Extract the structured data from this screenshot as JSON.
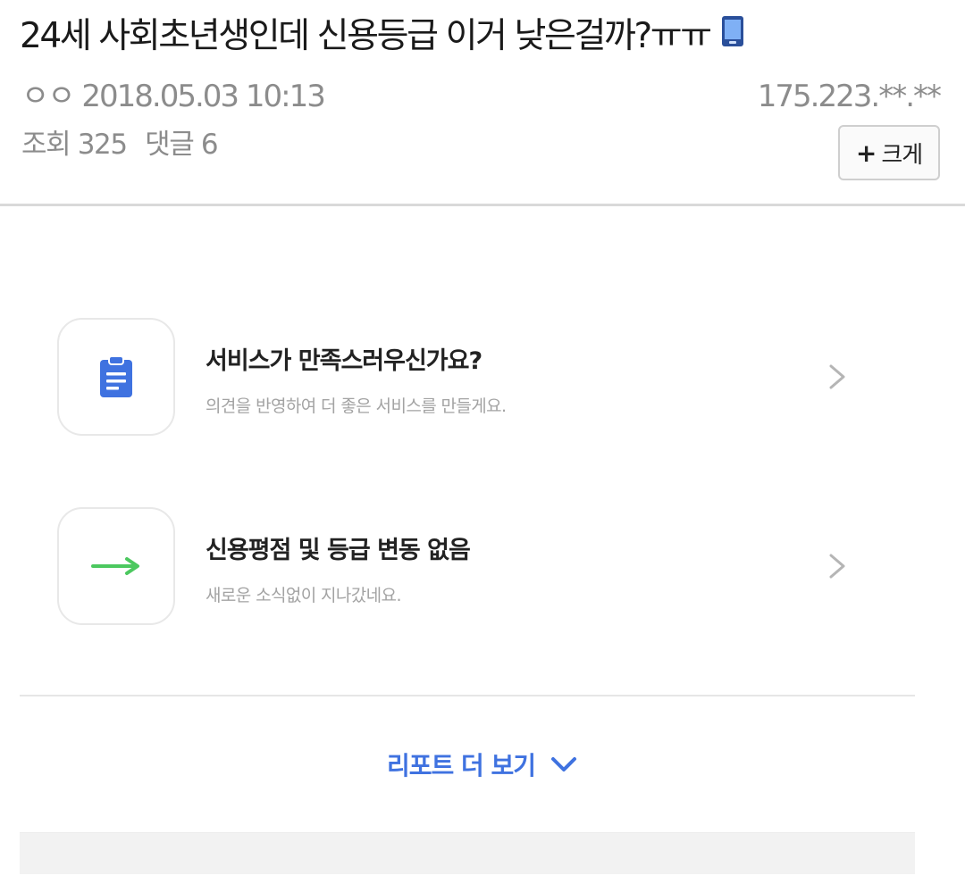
{
  "post": {
    "title": "24세 사회초년생인데 신용등급 이거 낮은걸까?ㅠㅠ",
    "author_date": "ㅇㅇ 2018.05.03 10:13",
    "ip": "175.223.**.**",
    "views_label": "조회 325",
    "comments_label": "댓글 6",
    "enlarge_plus": "+",
    "enlarge_label": "크게",
    "mobile_icon": "mobile-phone-icon"
  },
  "report": {
    "items": [
      {
        "title": "서비스가 만족스러우신가요?",
        "subtitle": "의견을 반영하여 더 좋은 서비스를 만들게요.",
        "icon": "clipboard-icon"
      },
      {
        "title": "신용평점 및 등급 변동 없음",
        "subtitle": "새로운 소식없이 지나갔네요.",
        "icon": "right-arrow-icon"
      }
    ],
    "more_label": "리포트 더 보기"
  },
  "colors": {
    "accent_blue": "#3f72e0",
    "arrow_green": "#4cc85f",
    "muted_text": "#8c8c8c"
  }
}
